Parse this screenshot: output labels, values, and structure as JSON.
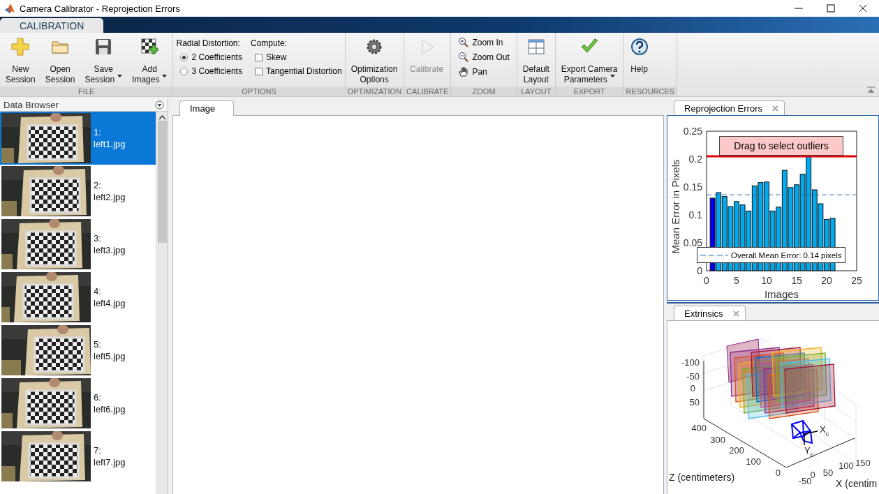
{
  "window": {
    "title": "Camera Calibrator - Reprojection Errors"
  },
  "ribbon_tabs": [
    {
      "label": "CALIBRATION",
      "selected": true
    }
  ],
  "toolstrip": {
    "groups": [
      {
        "label": "FILE",
        "kind": "buttons",
        "items": [
          {
            "lines": [
              "New",
              "Session"
            ],
            "dropdown": false,
            "disabled": false
          },
          {
            "lines": [
              "Open",
              "Session"
            ],
            "dropdown": false,
            "disabled": false
          },
          {
            "lines": [
              "Save",
              "Session"
            ],
            "dropdown": true,
            "disabled": false
          },
          {
            "lines": [
              "Add",
              "Images"
            ],
            "dropdown": true,
            "disabled": false
          }
        ]
      },
      {
        "label": "OPTIONS",
        "kind": "options",
        "radial_label": "Radial Distortion:",
        "radios": [
          {
            "label": "2 Coefficients",
            "selected": true
          },
          {
            "label": "3 Coefficients",
            "selected": false
          }
        ],
        "compute_label": "Compute:",
        "checks": [
          {
            "label": "Skew",
            "checked": false
          },
          {
            "label": "Tangential Distortion",
            "checked": false
          }
        ]
      },
      {
        "label": "OPTIMIZATION",
        "kind": "buttons",
        "items": [
          {
            "lines": [
              "Optimization",
              "Options"
            ],
            "dropdown": false,
            "disabled": false
          }
        ]
      },
      {
        "label": "CALIBRATE",
        "kind": "buttons",
        "items": [
          {
            "lines": [
              "Calibrate"
            ],
            "dropdown": false,
            "disabled": true
          }
        ]
      },
      {
        "label": "ZOOM",
        "kind": "small",
        "items": [
          {
            "label": "Zoom In"
          },
          {
            "label": "Zoom Out"
          },
          {
            "label": "Pan"
          }
        ]
      },
      {
        "label": "LAYOUT",
        "kind": "buttons",
        "items": [
          {
            "lines": [
              "Default",
              "Layout"
            ],
            "dropdown": false,
            "disabled": false
          }
        ]
      },
      {
        "label": "EXPORT",
        "kind": "buttons",
        "items": [
          {
            "lines": [
              "Export Camera",
              "Parameters"
            ],
            "dropdown": true,
            "disabled": false
          }
        ]
      },
      {
        "label": "RESOURCES",
        "kind": "buttons",
        "items": [
          {
            "lines": [
              "Help"
            ],
            "dropdown": false,
            "disabled": false
          }
        ]
      }
    ]
  },
  "data_browser": {
    "title": "Data Browser",
    "images": [
      {
        "index": "1:",
        "file": "left1.jpg",
        "selected": true
      },
      {
        "index": "2:",
        "file": "left2.jpg",
        "selected": false
      },
      {
        "index": "3:",
        "file": "left3.jpg",
        "selected": false
      },
      {
        "index": "4:",
        "file": "left4.jpg",
        "selected": false
      },
      {
        "index": "5:",
        "file": "left5.jpg",
        "selected": false
      },
      {
        "index": "6:",
        "file": "left6.jpg",
        "selected": false
      },
      {
        "index": "7:",
        "file": "left7.jpg",
        "selected": false
      }
    ]
  },
  "image_panel": {
    "tabs": [
      {
        "label": "Image",
        "selected": true
      }
    ]
  },
  "reprojection_panel": {
    "tabs": [
      {
        "label": "Reprojection Errors",
        "selected": true
      }
    ],
    "chart_data": {
      "type": "bar",
      "xlabel": "Images",
      "ylabel": "Mean Error in Pixels",
      "x": [
        1,
        2,
        3,
        4,
        5,
        6,
        7,
        8,
        9,
        10,
        11,
        12,
        13,
        14,
        15,
        16,
        17,
        18,
        19,
        20,
        21
      ],
      "series": [
        {
          "color": "#0000ee",
          "values": [
            0.13,
            null,
            null,
            null,
            null,
            null,
            null,
            null,
            null,
            null,
            null,
            null,
            null,
            null,
            null,
            null,
            null,
            null,
            null,
            null,
            null
          ]
        },
        {
          "color": "#00aaee",
          "values": [
            null,
            0.14,
            0.133,
            0.115,
            0.124,
            0.118,
            0.107,
            0.152,
            0.158,
            0.159,
            0.107,
            0.114,
            0.18,
            0.149,
            0.154,
            0.173,
            0.205,
            0.145,
            0.12,
            0.092,
            0.094
          ]
        }
      ],
      "xlim": [
        0,
        25
      ],
      "ylim": [
        0,
        0.25
      ],
      "xticks": [
        0,
        5,
        10,
        15,
        20,
        25
      ],
      "yticks": [
        0,
        0.05,
        0.1,
        0.15,
        0.2,
        0.25
      ],
      "ref_lines": [
        {
          "axis": "y",
          "value": 0.205,
          "color": "#e00000",
          "label": "Drag to select outliers"
        },
        {
          "axis": "y",
          "value": 0.136,
          "color": "#3070b0",
          "label": "Overall Mean Error: 0.14 pixels"
        }
      ]
    }
  },
  "extrinsics_panel": {
    "tabs": [
      {
        "label": "Extrinsics",
        "selected": true
      }
    ],
    "y_ticks": [
      "-100",
      "-50",
      "0",
      "50"
    ],
    "z_ticks": [
      "400",
      "300",
      "200",
      "100",
      "0"
    ],
    "x_ticks": [
      "-50",
      "0",
      "50",
      "100",
      "150"
    ],
    "z_label": "Z (centimeters)",
    "x_label": "X (centim",
    "camera_labels": [
      "X$_{c}$",
      "Y$_{c}$"
    ]
  }
}
